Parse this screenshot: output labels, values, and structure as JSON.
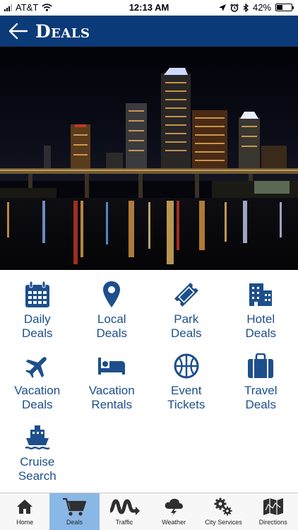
{
  "status_bar": {
    "carrier": "AT&T",
    "time": "12:13 AM",
    "battery_percent": "42%",
    "battery_level": 0.42,
    "icons": [
      "signal-icon",
      "wifi-icon",
      "location-icon",
      "alarm-icon",
      "bluetooth-icon",
      "battery-icon"
    ]
  },
  "header": {
    "title": "Deals",
    "back_icon": "back-arrow-icon",
    "background": "#0b3a78"
  },
  "hero": {
    "image": "night-city-skyline-over-river"
  },
  "categories": [
    {
      "label": "Daily\nDeals",
      "icon": "calendar-icon"
    },
    {
      "label": "Local\nDeals",
      "icon": "map-pin-icon"
    },
    {
      "label": "Park\nDeals",
      "icon": "ticket-icon"
    },
    {
      "label": "Hotel\nDeals",
      "icon": "hotel-building-icon"
    },
    {
      "label": "Vacation\nDeals",
      "icon": "airplane-icon"
    },
    {
      "label": "Vacation\nRentals",
      "icon": "bed-icon"
    },
    {
      "label": "Event\nTickets",
      "icon": "basketball-icon"
    },
    {
      "label": "Travel\nDeals",
      "icon": "suitcase-icon"
    },
    {
      "label": "Cruise\nSearch",
      "icon": "cruise-ship-icon"
    }
  ],
  "colors": {
    "accent": "#1d4f8c",
    "tab_active": "#8ab8e6"
  },
  "tabs": [
    {
      "label": "Home",
      "icon": "home-icon",
      "active": false
    },
    {
      "label": "Deals",
      "icon": "cart-icon",
      "active": true
    },
    {
      "label": "Traffic",
      "icon": "road-icon",
      "active": false
    },
    {
      "label": "Weather",
      "icon": "storm-cloud-icon",
      "active": false
    },
    {
      "label": "City Services",
      "icon": "gears-icon",
      "active": false
    },
    {
      "label": "Directions",
      "icon": "map-icon",
      "active": false
    }
  ]
}
